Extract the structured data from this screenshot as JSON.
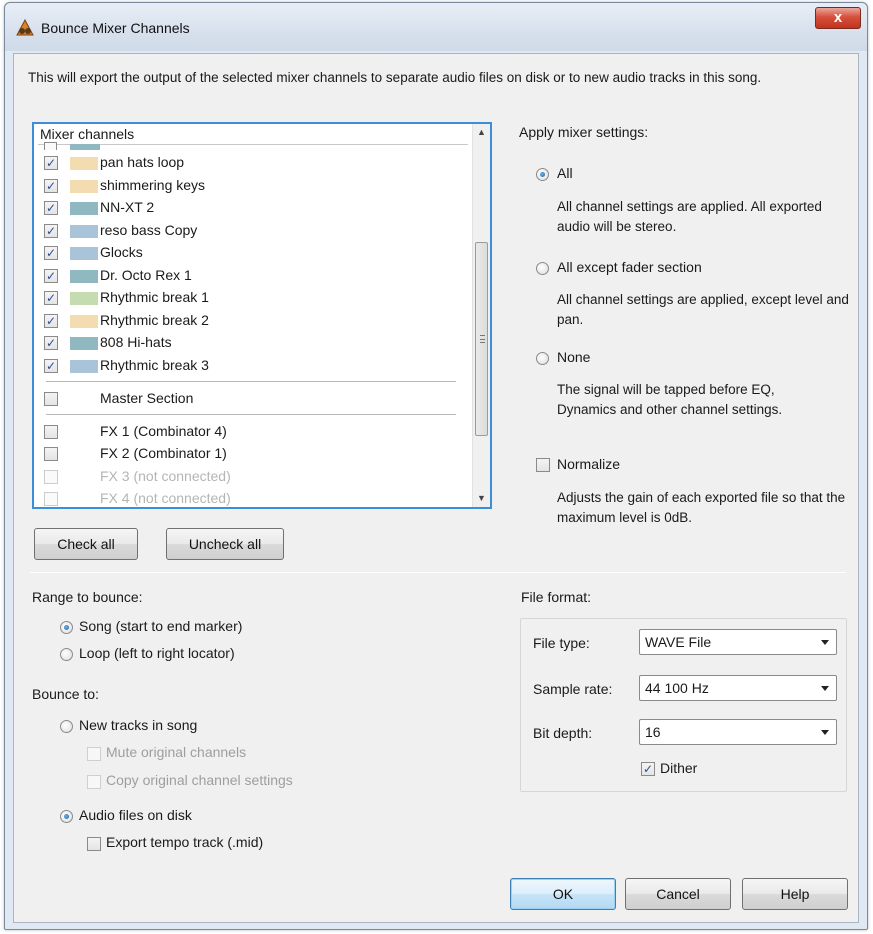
{
  "window": {
    "title": "Bounce Mixer Channels",
    "close_label": "x"
  },
  "intro": "This will export the output of the selected mixer channels to separate audio files on disk or to new audio tracks in this song.",
  "mixer_list": {
    "header": "Mixer channels",
    "rows": [
      {
        "label": "pan hats loop",
        "checked": true,
        "color": "#f3ddb0"
      },
      {
        "label": "shimmering keys",
        "checked": true,
        "color": "#f3ddb0"
      },
      {
        "label": "NN-XT 2",
        "checked": true,
        "color": "#8fb8c0"
      },
      {
        "label": "reso bass Copy",
        "checked": true,
        "color": "#a9c4d9"
      },
      {
        "label": "Glocks",
        "checked": true,
        "color": "#a9c4d9"
      },
      {
        "label": "Dr. Octo Rex 1",
        "checked": true,
        "color": "#8fb8c0"
      },
      {
        "label": "Rhythmic break 1",
        "checked": true,
        "color": "#c5dcb0"
      },
      {
        "label": "Rhythmic break 2",
        "checked": true,
        "color": "#f3ddb0"
      },
      {
        "label": "808 Hi-hats",
        "checked": true,
        "color": "#8fb8c0"
      },
      {
        "label": "Rhythmic break 3",
        "checked": true,
        "color": "#a9c4d9"
      }
    ],
    "master": {
      "label": "Master Section",
      "checked": false
    },
    "fx": [
      {
        "label": "FX 1 (Combinator 4)",
        "checked": false,
        "disabled": false
      },
      {
        "label": "FX 2 (Combinator 1)",
        "checked": false,
        "disabled": false
      },
      {
        "label": "FX 3 (not connected)",
        "checked": false,
        "disabled": true
      },
      {
        "label": "FX 4 (not connected)",
        "checked": false,
        "disabled": true
      }
    ]
  },
  "buttons": {
    "check_all": "Check all",
    "uncheck_all": "Uncheck all",
    "ok": "OK",
    "cancel": "Cancel",
    "help": "Help"
  },
  "apply_mixer": {
    "heading": "Apply mixer settings:",
    "all": {
      "label": "All",
      "desc": "All channel settings are applied. All exported audio will be stereo.",
      "selected": true
    },
    "except_fader": {
      "label": "All except fader section",
      "desc": "All channel settings are applied, except level and pan.",
      "selected": false
    },
    "none": {
      "label": "None",
      "desc": "The signal will be tapped before EQ, Dynamics and other channel settings.",
      "selected": false
    }
  },
  "normalize": {
    "label": "Normalize",
    "checked": false,
    "desc": "Adjusts the gain of each exported file so that the maximum level is 0dB."
  },
  "range": {
    "heading": "Range to bounce:",
    "song": {
      "label": "Song (start to end marker)",
      "selected": true
    },
    "loop": {
      "label": "Loop (left to right locator)",
      "selected": false
    }
  },
  "bounce_to": {
    "heading": "Bounce to:",
    "new_tracks": {
      "label": "New tracks in song",
      "selected": false
    },
    "mute_original": {
      "label": "Mute original channels",
      "checked": false
    },
    "copy_settings": {
      "label": "Copy original channel settings",
      "checked": false
    },
    "audio_files": {
      "label": "Audio files on disk",
      "selected": true
    },
    "export_tempo": {
      "label": "Export tempo track (.mid)",
      "checked": false
    }
  },
  "file_format": {
    "heading": "File format:",
    "file_type": {
      "label": "File type:",
      "value": "WAVE File"
    },
    "sample_rate": {
      "label": "Sample rate:",
      "value": "44 100 Hz"
    },
    "bit_depth": {
      "label": "Bit depth:",
      "value": "16"
    },
    "dither": {
      "label": "Dither",
      "checked": true
    }
  }
}
